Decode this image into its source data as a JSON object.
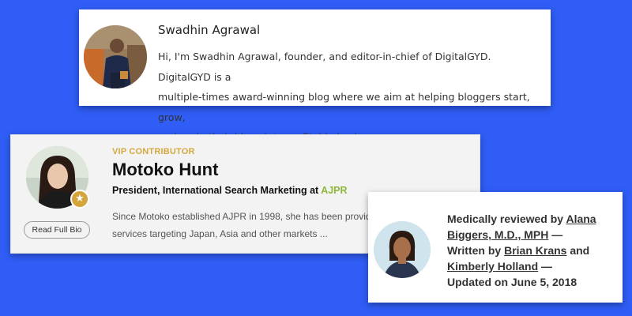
{
  "card1": {
    "name": "Swadhin Agrawal",
    "bio_line1": "Hi, I'm Swadhin Agrawal, founder, and editor-in-chief of DigitalGYD. DigitalGYD is a",
    "bio_line2": "multiple-times award-winning blog where we aim at helping bloggers start, grow,",
    "bio_line3": "and scale their blogs into profitable businesses."
  },
  "card2": {
    "tag": "VIP CONTRIBUTOR",
    "name": "Motoko Hunt",
    "title_prefix": "President, International Search Marketing at ",
    "company": "AJPR",
    "desc_line1": "Since Motoko established AJPR in 1998, she has been provid",
    "desc_line2": "services targeting Japan, Asia and other markets ...",
    "button_label": "Read Full Bio",
    "accent_color": "#d6a840",
    "company_color": "#8db73b"
  },
  "card3": {
    "reviewed_prefix": "Medically reviewed by ",
    "reviewer_1": "Alana",
    "reviewer_2": "Biggers, M.D., MPH",
    "dash1": " —",
    "written_prefix": "Written by ",
    "writer_1": "Brian Krans",
    "and": " and",
    "writer_2": "Kimberly Holland",
    "dash2": " —",
    "updated": "Updated on June 5, 2018"
  }
}
